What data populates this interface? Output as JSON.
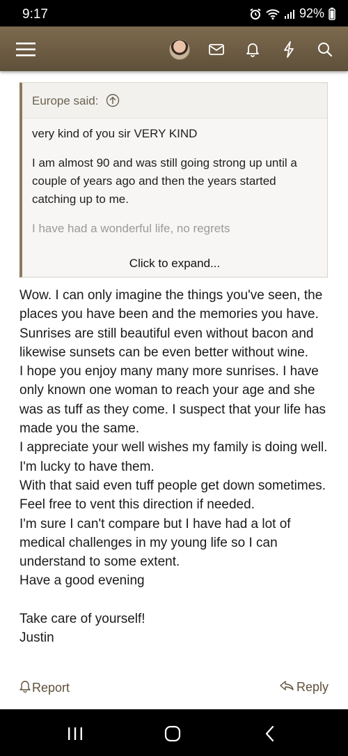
{
  "status_bar": {
    "time": "9:17",
    "battery": "92%"
  },
  "nav": {
    "icons": [
      "menu-icon",
      "avatar",
      "mail-icon",
      "bell-icon",
      "lightning-icon",
      "search-icon"
    ]
  },
  "quote": {
    "author": "Europe said:",
    "paragraphs": [
      "very kind of you sir VERY KIND",
      "I am almost 90 and was still going strong up until a couple of years ago and then the years started catching up to me.",
      "I have had a wonderful life, no regrets"
    ],
    "expand_label": "Click to expand..."
  },
  "post": {
    "lines": [
      "Wow. I can only imagine the things you've seen, the places you have been and the memories you have. Sunrises are still beautiful even without bacon and likewise sunsets can be even better without wine.",
      "I hope you enjoy many many more sunrises. I have only known one woman to reach your age and she was as tuff as they come. I suspect that your life has made you the same.",
      "I appreciate your well wishes my family is doing well. I'm lucky to have them.",
      "With that said even tuff people get down sometimes. Feel free to vent this direction if needed.",
      "I'm sure I can't compare but I have had a lot of medical challenges in my young life so I can understand to some extent.",
      "Have a good evening",
      "",
      "Take care of yourself!",
      "Justin"
    ]
  },
  "actions": {
    "report": "Report",
    "reply": "Reply"
  },
  "colors": {
    "nav_bg": "#6e5e45",
    "accent": "#8c7a5c"
  }
}
